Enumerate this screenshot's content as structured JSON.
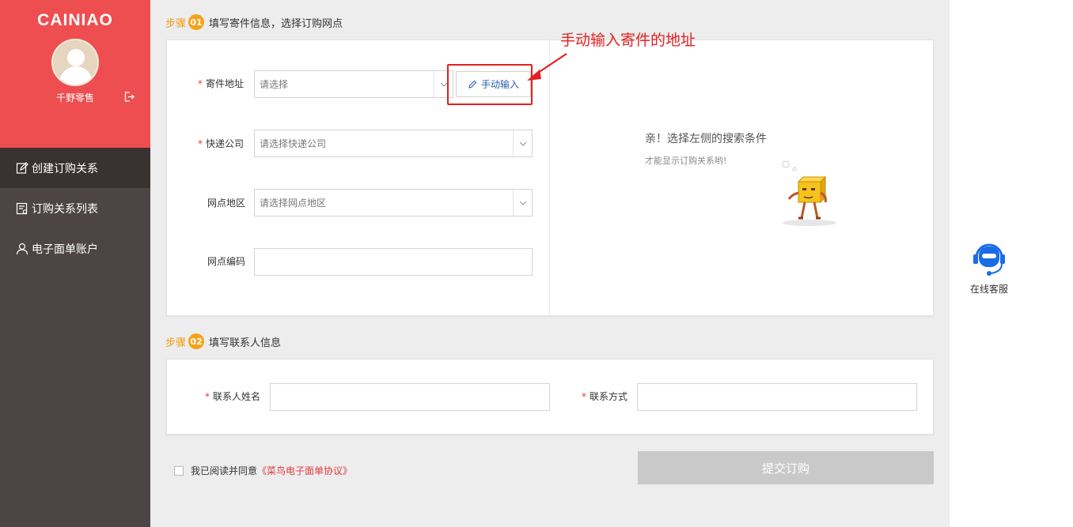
{
  "sidebar": {
    "logo": "CAINIAO",
    "username": "千野零售",
    "items": [
      {
        "label": "创建订购关系",
        "icon": "edit-icon",
        "active": true
      },
      {
        "label": "订购关系列表",
        "icon": "list-icon",
        "active": false
      },
      {
        "label": "电子面单账户",
        "icon": "user-icon",
        "active": false
      }
    ]
  },
  "step1": {
    "word": "步骤",
    "num": "01",
    "title": "填写寄件信息，选择订购网点"
  },
  "step2": {
    "word": "步骤",
    "num": "02",
    "title": "填写联系人信息"
  },
  "form1": {
    "address_label": "寄件地址",
    "address_placeholder": "请选择",
    "manual_button": "手动输入",
    "courier_label": "快递公司",
    "courier_placeholder": "请选择快递公司",
    "region_label": "网点地区",
    "region_placeholder": "请选择网点地区",
    "code_label": "网点编码",
    "code_value": ""
  },
  "empty_state": {
    "message": "亲！选择左侧的搜索条件",
    "sub": "才能显示订购关系哟!"
  },
  "annotation": "手动输入寄件的地址",
  "form2": {
    "contact_name_label": "联系人姓名",
    "contact_name_value": "",
    "contact_phone_label": "联系方式",
    "contact_phone_value": ""
  },
  "agreement": {
    "text": "我已阅读并同意",
    "link": "《菜鸟电子面单协议》"
  },
  "submit_label": "提交订购",
  "customer_service_label": "在线客服",
  "colors": {
    "brand": "#ee4e50",
    "sidebar": "#4d4545",
    "step": "#f5a21a",
    "annotation": "#e41f1f"
  }
}
